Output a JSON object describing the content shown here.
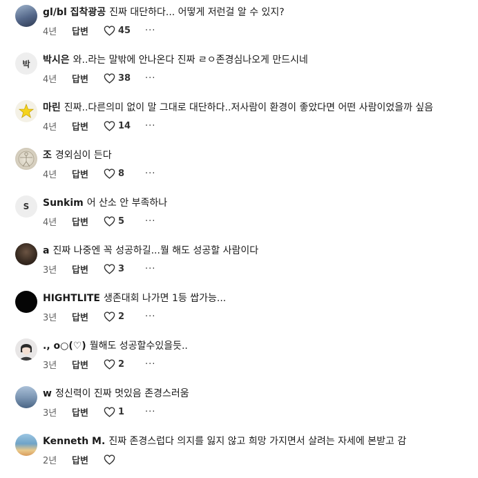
{
  "labels": {
    "reply": "답변",
    "more": "···"
  },
  "comments": [
    {
      "author": "gl/bl 집착광공",
      "text": "진짜 대단하다... 어떻게 저런걸 알 수 있지?",
      "time": "4년",
      "likes": "45",
      "avatar_text": "",
      "avatar_color": "#6e86a8"
    },
    {
      "author": "박시은",
      "text": "와..라는 말밖에 안나온다 진짜 ㄹㅇ존경심나오게 만드시네",
      "time": "4년",
      "likes": "38",
      "avatar_text": "박",
      "avatar_color": "#eeeeee"
    },
    {
      "author": "마린",
      "text": "진짜..다른의미 없이 말 그대로 대단하다..저사람이 환경이 좋았다면 어떤 사람이었을까 싶음",
      "time": "4년",
      "likes": "14",
      "avatar_text": "",
      "avatar_color": "#f4f1e6"
    },
    {
      "author": "조",
      "text": "경외심이 든다",
      "time": "4년",
      "likes": "8",
      "avatar_text": "",
      "avatar_color": "#d9d3c4"
    },
    {
      "author": "Sunkim",
      "text": "어 산소 안 부족하나",
      "time": "4년",
      "likes": "5",
      "avatar_text": "S",
      "avatar_color": "#eeeeee"
    },
    {
      "author": "a",
      "text": "진짜 나중엔 꼭 성공하길...뭘 해도 성공할 사람이다",
      "time": "3년",
      "likes": "3",
      "avatar_text": "",
      "avatar_color": "#4a3a2e"
    },
    {
      "author": "HIGHTLITE",
      "text": "생존대회 나가면 1등 쌉가능...",
      "time": "3년",
      "likes": "2",
      "avatar_text": "",
      "avatar_color": "#050505"
    },
    {
      "author": "., o○(♡)",
      "text": "뭘해도 성공할수있을듯..",
      "time": "3년",
      "likes": "2",
      "avatar_text": "",
      "avatar_color": "#e8e6e6"
    },
    {
      "author": "w",
      "text": "정신력이 진짜 멋있음 존경스러움",
      "time": "3년",
      "likes": "1",
      "avatar_text": "",
      "avatar_color": "#8ea6c1"
    },
    {
      "author": "Kenneth M.",
      "text": "진짜 존경스럽다 의지를 잃지 않고 희망 가지면서 살려는 자세에 본받고 감",
      "time": "2년",
      "likes": "",
      "avatar_text": "",
      "avatar_color": "#7fb0cf"
    }
  ]
}
